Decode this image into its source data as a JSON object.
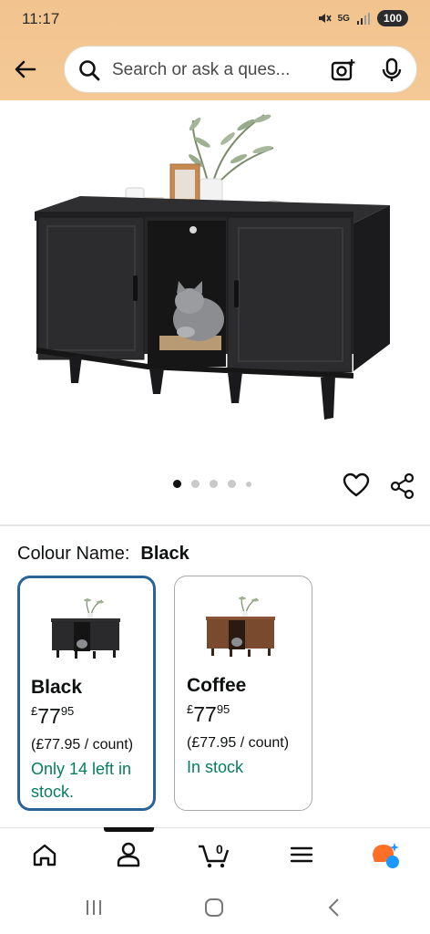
{
  "status_bar": {
    "time": "11:17",
    "network": "5G",
    "battery": "100"
  },
  "search": {
    "placeholder": "Search or ask a ques..."
  },
  "gallery": {
    "total_images": 5,
    "active_index": 0
  },
  "variant_selector": {
    "label": "Colour Name:",
    "selected_value": "Black",
    "options": [
      {
        "name": "Black",
        "currency": "£",
        "price_whole": "77",
        "price_fraction": "95",
        "unit_price": "(£77.95 / count)",
        "availability": "Only 14 left in stock.",
        "selected": true
      },
      {
        "name": "Coffee",
        "currency": "£",
        "price_whole": "77",
        "price_fraction": "95",
        "unit_price": "(£77.95 / count)",
        "availability": "In stock",
        "selected": false
      }
    ]
  },
  "bottom_nav": {
    "cart_count": "0",
    "items": [
      "home-icon",
      "account-icon",
      "cart-icon",
      "menu-icon",
      "rufus-icon"
    ]
  },
  "colors": {
    "header_bg": "#f3c592",
    "selected_border": "#2a6496",
    "stock_green": "#067d62",
    "rufus_orange": "#ff6e27",
    "rufus_blue": "#1a98ff"
  }
}
